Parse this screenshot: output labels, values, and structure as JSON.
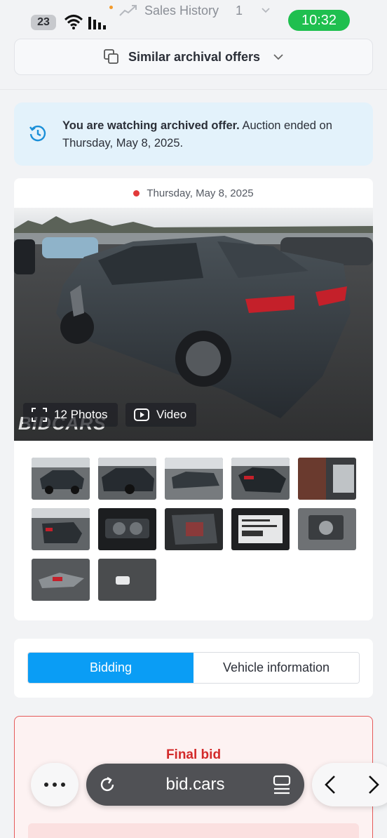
{
  "status_bar": {
    "battery": "23",
    "time": "10:32"
  },
  "header": {
    "sales_history_label": "Sales History",
    "sales_history_count": "1"
  },
  "similar_offers": {
    "label": "Similar archival offers"
  },
  "notice": {
    "bold": "You are watching archived offer.",
    "rest": " Auction ended on Thursday, May 8, 2025."
  },
  "gallery": {
    "date": "Thursday, May 8, 2025",
    "photos_label": "12 Photos",
    "video_label": "Video",
    "watermark": "BIDCARS",
    "thumbnail_count": 12
  },
  "tabs": [
    {
      "label": "Bidding",
      "active": true
    },
    {
      "label": "Vehicle information",
      "active": false
    }
  ],
  "final_bid": {
    "title": "Final bid"
  },
  "browser": {
    "url": "bid.cars"
  },
  "colors": {
    "accent": "#0a9df5",
    "danger": "#d32b2b",
    "time_pill": "#1fbf4f",
    "notice_bg": "#e3f2fb"
  }
}
